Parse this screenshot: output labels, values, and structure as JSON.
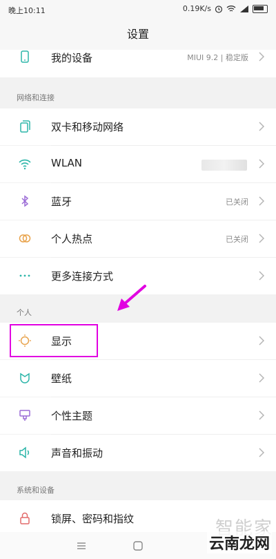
{
  "status_bar": {
    "time": "晚上10:11",
    "speed": "0.19K/s"
  },
  "header": {
    "title": "设置"
  },
  "top_item": {
    "label": "我的设备",
    "status": "MIUI 9.2 | 稳定版"
  },
  "sections": {
    "network": {
      "title": "网络和连接"
    },
    "personal": {
      "title": "个人"
    },
    "system": {
      "title": "系统和设备"
    }
  },
  "network_items": [
    {
      "label": "双卡和移动网络",
      "icon": "sim-card-icon"
    },
    {
      "label": "WLAN",
      "icon": "wifi-icon"
    },
    {
      "label": "蓝牙",
      "status": "已关闭",
      "icon": "bluetooth-icon"
    },
    {
      "label": "个人热点",
      "status": "已关闭",
      "icon": "hotspot-icon"
    },
    {
      "label": "更多连接方式",
      "icon": "more-dots-icon"
    }
  ],
  "personal_items": [
    {
      "label": "显示",
      "icon": "brightness-icon"
    },
    {
      "label": "壁纸",
      "icon": "wallpaper-icon"
    },
    {
      "label": "个性主题",
      "icon": "theme-icon"
    },
    {
      "label": "声音和振动",
      "icon": "speaker-icon"
    }
  ],
  "system_items": [
    {
      "label": "锁屏、密码和指纹",
      "icon": "lock-icon"
    }
  ],
  "watermark": {
    "line1": "智能家",
    "line2": "云南龙网"
  },
  "colors": {
    "highlight": "#e100e1",
    "orange": "#e8a24a",
    "teal": "#2bb5a8",
    "purple": "#9b6bd6"
  }
}
